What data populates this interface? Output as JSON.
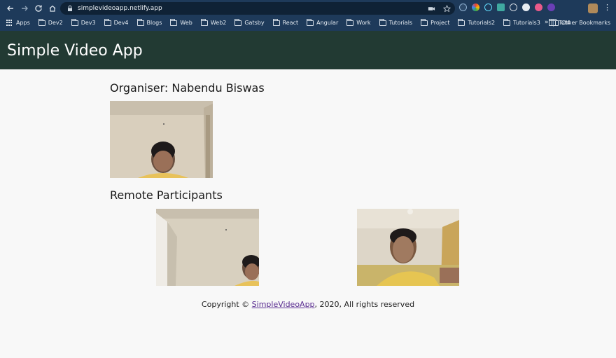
{
  "browser": {
    "url": "simplevideoapp.netlify.app",
    "bookmarks": [
      "Apps",
      "Dev2",
      "Dev3",
      "Dev4",
      "Blogs",
      "Web",
      "Web2",
      "Gatsby",
      "React",
      "Angular",
      "Work",
      "Tutorials",
      "Project",
      "Tutorials2",
      "Tutorials3",
      "Tut4"
    ],
    "overflow_label": "»",
    "other_bookmarks": "Other Bookmarks"
  },
  "header": {
    "title": "Simple Video App"
  },
  "organiser": {
    "label": "Organiser: Nabendu Biswas"
  },
  "remote": {
    "heading": "Remote Participants"
  },
  "footer": {
    "prefix": "Copyright ©",
    "link_text": "SimpleVideoApp",
    "suffix": ", 2020, All rights reserved"
  },
  "colors": {
    "header_bg": "#223a33",
    "browser_bg": "#1e3a5a",
    "page_bg": "#f8f8f8",
    "link": "#5a2d91"
  }
}
